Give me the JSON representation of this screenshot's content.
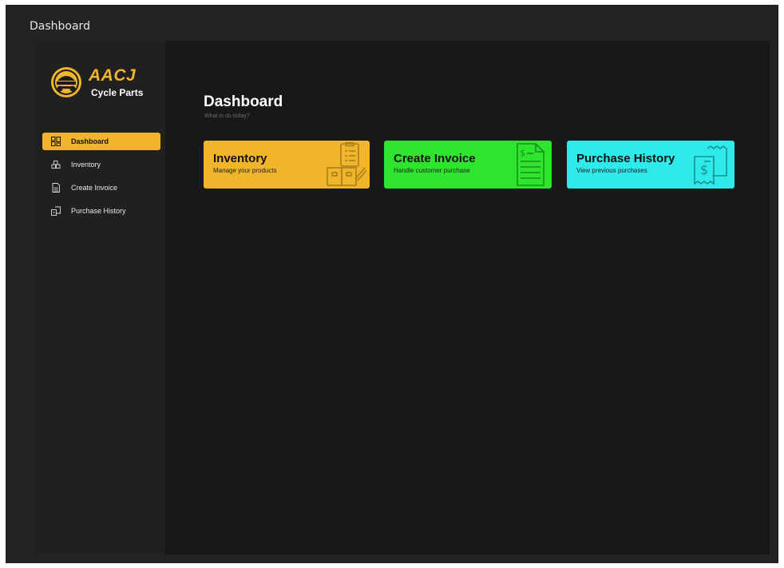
{
  "window": {
    "title": "Dashboard"
  },
  "sidebar": {
    "brand_name": "AACJ",
    "brand_subtitle": "Cycle Parts",
    "items": [
      {
        "label": "Dashboard",
        "icon": "grid-icon",
        "active": true
      },
      {
        "label": "Inventory",
        "icon": "boxes-icon",
        "active": false
      },
      {
        "label": "Create Invoice",
        "icon": "invoice-icon",
        "active": false
      },
      {
        "label": "Purchase History",
        "icon": "history-icon",
        "active": false
      }
    ]
  },
  "main": {
    "title": "Dashboard",
    "subtitle": "What to do today?",
    "cards": [
      {
        "title": "Inventory",
        "subtitle": "Manage your products",
        "color": "#f0b52a",
        "icon": "inventory-icon"
      },
      {
        "title": "Create Invoice",
        "subtitle": "Handle customer purchase",
        "color": "#2ee52e",
        "icon": "invoice-document-icon"
      },
      {
        "title": "Purchase History",
        "subtitle": "View previous purchases",
        "color": "#2eeaea",
        "icon": "receipt-icon"
      }
    ]
  },
  "colors": {
    "accent": "#f0b52a",
    "window_bg": "#232323",
    "sidebar_bg": "#202020",
    "main_bg": "#181818"
  }
}
